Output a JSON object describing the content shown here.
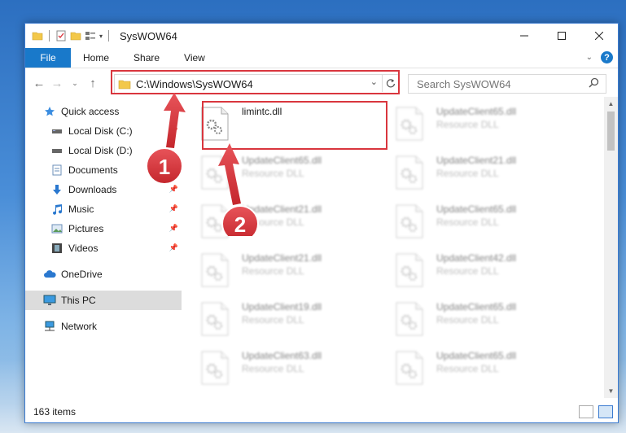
{
  "window": {
    "title": "SysWOW64",
    "status_count": "163 items"
  },
  "ribbon": {
    "tabs": [
      "File",
      "Home",
      "Share",
      "View"
    ]
  },
  "address": {
    "path": "C:\\Windows\\SysWOW64"
  },
  "search": {
    "placeholder": "Search SysWOW64"
  },
  "sidebar": {
    "items": [
      {
        "label": "Quick access",
        "icon": "star-icon"
      },
      {
        "label": "Local Disk (C:)",
        "icon": "drive-icon"
      },
      {
        "label": "Local Disk (D:)",
        "icon": "drive-icon"
      },
      {
        "label": "Documents",
        "icon": "documents-icon"
      },
      {
        "label": "Downloads",
        "icon": "download-arrow-icon"
      },
      {
        "label": "Music",
        "icon": "music-note-icon"
      },
      {
        "label": "Pictures",
        "icon": "pictures-icon"
      },
      {
        "label": "Videos",
        "icon": "film-icon"
      },
      {
        "label": "OneDrive",
        "icon": "cloud-icon"
      },
      {
        "label": "This PC",
        "icon": "monitor-icon",
        "selected": true
      },
      {
        "label": "Network",
        "icon": "network-icon"
      }
    ]
  },
  "files": [
    {
      "name": "limintc.dll",
      "type": "",
      "highlighted": true
    },
    {
      "name": "UpdateClient65.dll",
      "type": "Resource DLL"
    },
    {
      "name": "UpdateClient65.dll",
      "type": "Resource DLL"
    },
    {
      "name": "UpdateClient21.dll",
      "type": "Resource DLL"
    },
    {
      "name": "UpdateClient21.dll",
      "type": "Resource DLL"
    },
    {
      "name": "UpdateClient65.dll",
      "type": "Resource DLL"
    },
    {
      "name": "UpdateClient21.dll",
      "type": "Resource DLL"
    },
    {
      "name": "UpdateClient42.dll",
      "type": "Resource DLL"
    },
    {
      "name": "UpdateClient19.dll",
      "type": "Resource DLL"
    },
    {
      "name": "UpdateClient65.dll",
      "type": "Resource DLL"
    },
    {
      "name": "UpdateClient63.dll",
      "type": "Resource DLL"
    },
    {
      "name": "UpdateClient65.dll",
      "type": "Resource DLL"
    }
  ],
  "callouts": [
    "1",
    "2"
  ],
  "colors": {
    "accent": "#1979ca",
    "highlight": "#d9363e"
  }
}
